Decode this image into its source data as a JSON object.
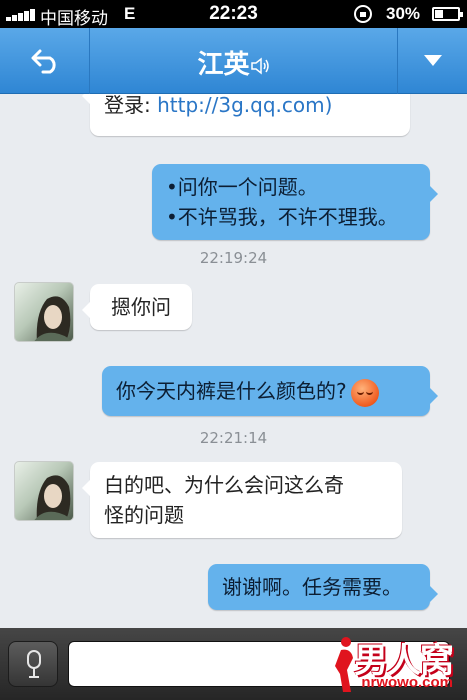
{
  "status_bar": {
    "carrier": "中国移动",
    "network": "E",
    "time": "22:23",
    "battery_percent": "30%"
  },
  "header": {
    "title": "江英",
    "back_icon": "back-arrow-icon",
    "menu_icon": "dropdown-triangle-icon",
    "speaker_icon": "speaker-icon"
  },
  "messages": [
    {
      "direction": "in",
      "text_prefix": "登录: ",
      "link": "http://3g.qq.com)"
    },
    {
      "direction": "out",
      "lines": [
        "•问你一个问题。",
        "•不许骂我，不许不理我。"
      ]
    },
    {
      "type": "timestamp",
      "text": "22:19:24"
    },
    {
      "direction": "in",
      "text": "摁你问"
    },
    {
      "direction": "out",
      "text": "你今天内裤是什么颜色的?",
      "emoji": "blush-emoji-icon"
    },
    {
      "type": "timestamp",
      "text": "22:21:14"
    },
    {
      "direction": "in",
      "lines": [
        "白的吧、为什么会问这么奇",
        "怪的问题"
      ]
    },
    {
      "direction": "out",
      "text": "谢谢啊。任务需要。"
    }
  ],
  "input_bar": {
    "voice_icon": "microphone-icon",
    "message_value": ""
  },
  "watermark": {
    "brand": "男人窝",
    "url": "nrwowo.com"
  },
  "colors": {
    "header_blue": "#2f86d4",
    "outgoing_bubble": "#64b2ec",
    "incoming_bubble": "#ffffff",
    "chat_background": "#e9ecf0",
    "link": "#2a76c6",
    "watermark_red": "#e0141e"
  }
}
